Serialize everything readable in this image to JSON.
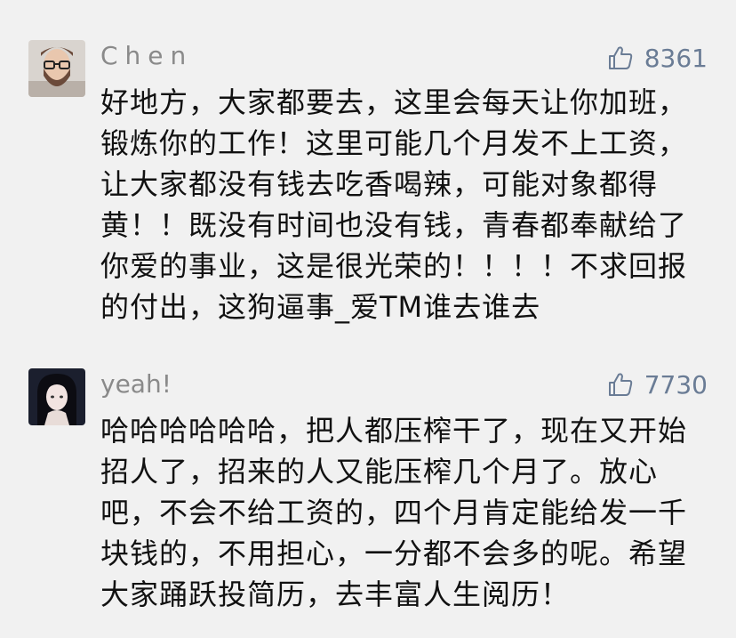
{
  "comments": [
    {
      "username": "Chen",
      "likes": "8361",
      "lines": [
        "好地方，大家都要去，这里会每天让你加班，",
        "锻炼你的工作！这里可能几个月发不上工资，",
        "让大家都没有钱去吃香喝辣，可能对象都得",
        "黄！！既没有时间也没有钱，青春都奉献给了",
        "你爱的事业，这是很光荣的！！！！不求回报",
        "的付出，这狗逼事_爱TM谁去谁去"
      ]
    },
    {
      "username": "yeah!",
      "likes": "7730",
      "lines": [
        "哈哈哈哈哈哈，把人都压榨干了，现在又开始",
        "招人了，招来的人又能压榨几个月了。放心",
        "吧，不会不给工资的，四个月肯定能给发一千",
        "块钱的，不用担心，一分都不会多的呢。希望",
        "大家踊跃投简历，去丰富人生阅历！"
      ]
    }
  ],
  "icons": {
    "like": "thumbs-up-icon",
    "avatar1": "bearded-man-avatar",
    "avatar2": "anime-girl-avatar"
  },
  "colors": {
    "background": "#f1f1f1",
    "username": "#8a8a8a",
    "likes": "#6a7c95",
    "text": "#111111"
  }
}
